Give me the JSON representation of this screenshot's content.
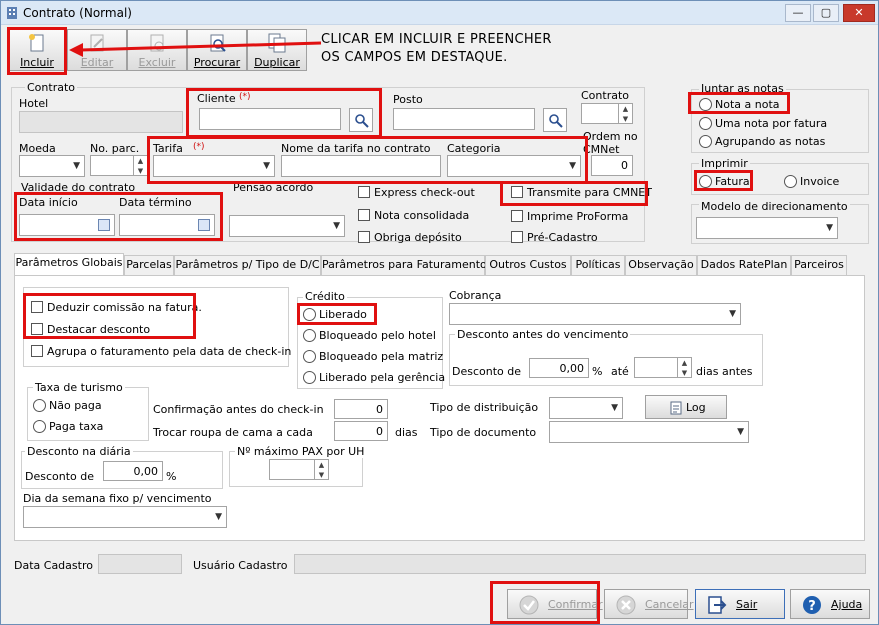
{
  "window": {
    "title": "Contrato (Normal)"
  },
  "toolbar": [
    {
      "label": "Incluir",
      "icon": "new-document-icon",
      "enabled": true
    },
    {
      "label": "Editar",
      "icon": "edit-icon",
      "enabled": false
    },
    {
      "label": "Excluir",
      "icon": "delete-icon",
      "enabled": false
    },
    {
      "label": "Procurar",
      "icon": "search-document-icon",
      "enabled": true
    },
    {
      "label": "Duplicar",
      "icon": "duplicate-icon",
      "enabled": true
    }
  ],
  "instruction": {
    "line1": "CLICAR EM INCLUIR E PREENCHER",
    "line2": "OS CAMPOS EM DESTAQUE."
  },
  "contrato_group": {
    "title": "Contrato",
    "hotel": "Hotel",
    "cliente": "Cliente",
    "required_mark": "(*)",
    "posto": "Posto",
    "contrato": "Contrato",
    "ordem_cmnet": "Ordem no CMNet",
    "ordem_cmnet_value": "0",
    "moeda": "Moeda",
    "no_parc": "No. parc.",
    "tarifa": "Tarifa",
    "nome_tarifa": "Nome da tarifa no contrato",
    "categoria": "Categoria"
  },
  "validade": {
    "title": "Validade do contrato",
    "data_inicio": "Data início",
    "data_termino": "Data término"
  },
  "pensao": "Pensão acordo",
  "checks_top": {
    "express_checkout": "Express check-out",
    "nota_consolidada": "Nota consolidada",
    "obriga_deposito": "Obriga depósito",
    "transmite_cmnet": "Transmite para CMNET",
    "imprime_proforma": "Imprime ProForma",
    "pre_cadastro": "Pré-Cadastro"
  },
  "juntar_notas": {
    "title": "Juntar as notas",
    "opt1": "Nota a nota",
    "opt2": "Uma nota por fatura",
    "opt3": "Agrupando as notas"
  },
  "imprimir": {
    "title": "Imprimir",
    "opt1": "Fatura",
    "opt2": "Invoice"
  },
  "modelo_direcionamento": "Modelo de direcionamento",
  "tabs": [
    "Parâmetros Globais",
    "Parcelas",
    "Parâmetros p/ Tipo de D/C",
    "Parâmetros para Faturamento",
    "Outros Custos",
    "Políticas",
    "Observação",
    "Dados RatePlan",
    "Parceiros"
  ],
  "panel": {
    "deduzir": "Deduzir comissão na fatura.",
    "destacar": "Destacar desconto",
    "agrupa": "Agrupa o faturamento pela data de check-in",
    "credito": {
      "title": "Crédito",
      "opt1": "Liberado",
      "opt2": "Bloqueado pelo hotel",
      "opt3": "Bloqueado pela matriz",
      "opt4": "Liberado pela gerência"
    },
    "cobranca": "Cobrança",
    "desc_venc": {
      "title": "Desconto antes do vencimento",
      "desconto_de": "Desconto de",
      "value": "0,00",
      "pct": "%",
      "ate": "até",
      "dias_antes": "dias antes"
    },
    "taxa_turismo": {
      "title": "Taxa de turismo",
      "opt1": "Não paga",
      "opt2": "Paga taxa"
    },
    "confirmacao": "Confirmação antes do check-in",
    "confirmacao_value": "0",
    "trocar_roupa": "Trocar roupa de cama a cada",
    "trocar_value": "0",
    "dias": "dias",
    "tipo_distribuicao": "Tipo de distribuição",
    "log": "Log",
    "tipo_documento": "Tipo de documento",
    "desc_diaria": {
      "title": "Desconto na diária",
      "desconto_de": "Desconto de",
      "value": "0,00",
      "pct": "%"
    },
    "max_pax": "Nº máximo PAX por UH",
    "dia_semana": "Dia da semana fixo p/ vencimento"
  },
  "footer": {
    "data_cadastro": "Data Cadastro",
    "usuario_cadastro": "Usuário Cadastro"
  },
  "buttons": [
    {
      "label": "Confirmar",
      "icon": "check-icon",
      "enabled": false
    },
    {
      "label": "Cancelar",
      "icon": "cancel-icon",
      "enabled": false
    },
    {
      "label": "Sair",
      "icon": "exit-icon",
      "enabled": true
    },
    {
      "label": "Ajuda",
      "icon": "help-icon",
      "enabled": true
    }
  ],
  "colors": {
    "highlight": "#e01010",
    "arrow": "#e01010"
  }
}
